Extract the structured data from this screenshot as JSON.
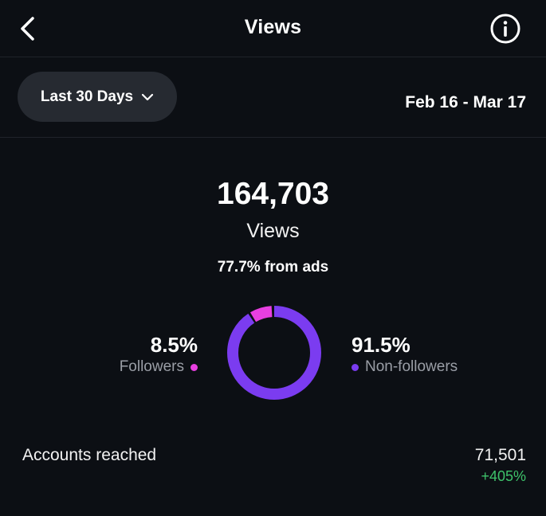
{
  "header": {
    "title": "Views",
    "back_icon": "chevron-left-icon",
    "info_icon": "info-icon"
  },
  "filter": {
    "range_label": "Last 30 Days",
    "dropdown_icon": "chevron-down-icon",
    "date_range": "Feb 16 - Mar 17"
  },
  "summary": {
    "total": "164,703",
    "label": "Views",
    "ads_note": "77.7% from ads"
  },
  "audience": {
    "followers": {
      "percent": "8.5%",
      "label": "Followers",
      "value": 8.5,
      "color": "#e83fe0"
    },
    "non_followers": {
      "percent": "91.5%",
      "label": "Non-followers",
      "value": 91.5,
      "color": "#7b3cf0"
    }
  },
  "accounts_reached": {
    "label": "Accounts reached",
    "value": "71,501",
    "change": "+405%",
    "change_color": "#3ec26a"
  }
}
